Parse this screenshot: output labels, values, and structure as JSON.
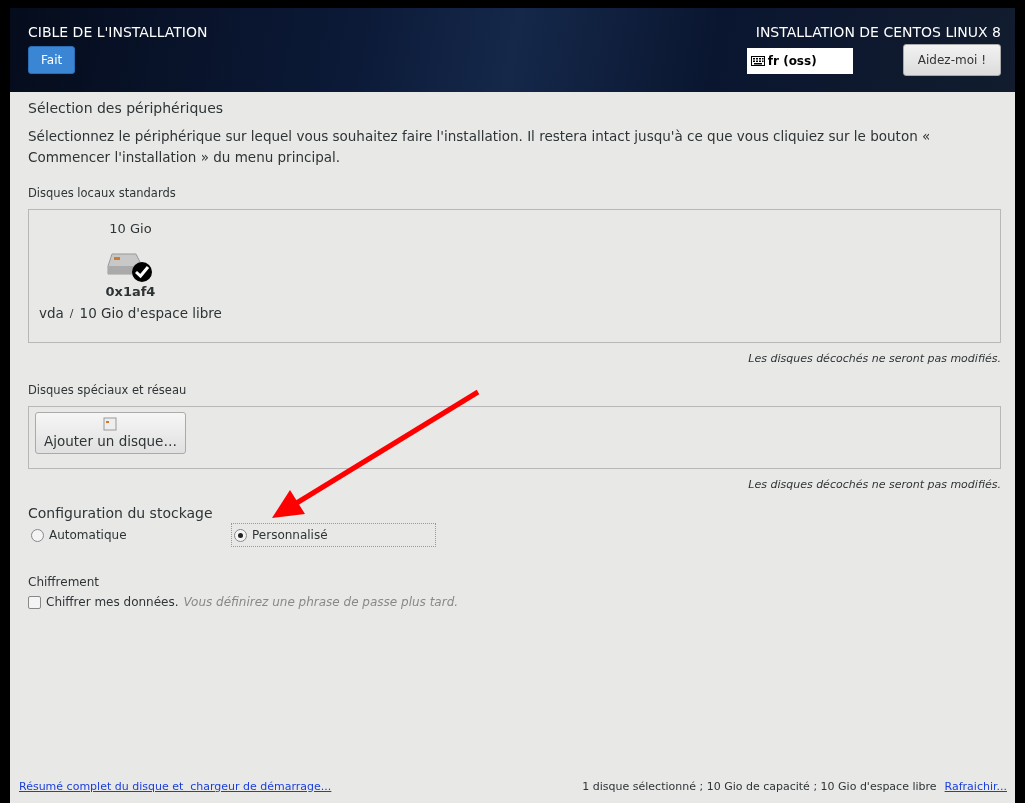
{
  "header": {
    "title": "CIBLE DE L'INSTALLATION",
    "done_button": "Fait",
    "product": "INSTALLATION DE CENTOS LINUX 8",
    "keyboard_layout": "fr (oss)",
    "help_button": "Aidez-moi !"
  },
  "device_selection": {
    "heading": "Sélection des périphériques",
    "description": "Sélectionnez le périphérique sur lequel vous souhaitez faire l'installation. Il restera intact jusqu'à ce que vous cliquiez sur le bouton « Commencer l'installation » du menu principal."
  },
  "local_disks": {
    "heading": "Disques locaux standards",
    "disks": [
      {
        "size": "10 Gio",
        "name": "0x1af4",
        "device": "vda",
        "separator": "/",
        "free": "10 Gio d'espace libre",
        "selected": true
      }
    ],
    "note": "Les disques décochés ne seront pas modifiés."
  },
  "special_disks": {
    "heading": "Disques spéciaux et réseau",
    "add_button": "Ajouter un disque…",
    "note": "Les disques décochés ne seront pas modifiés."
  },
  "storage": {
    "heading": "Configuration du stockage",
    "options": [
      {
        "label": "Automatique",
        "selected": false
      },
      {
        "label": "Personnalisé",
        "selected": true
      }
    ]
  },
  "encryption": {
    "heading": "Chiffrement",
    "checkbox": {
      "label": "Chiffrer mes données.",
      "hint": "Vous définirez une phrase de passe plus tard.",
      "checked": false
    }
  },
  "footer": {
    "summary_link": "Résumé complet du disque et  chargeur de démarrage...",
    "status": "1 disque sélectionné ; 10 Gio de capacité ; 10 Gio d'espace libre",
    "refresh_link": "Rafraichir..."
  }
}
